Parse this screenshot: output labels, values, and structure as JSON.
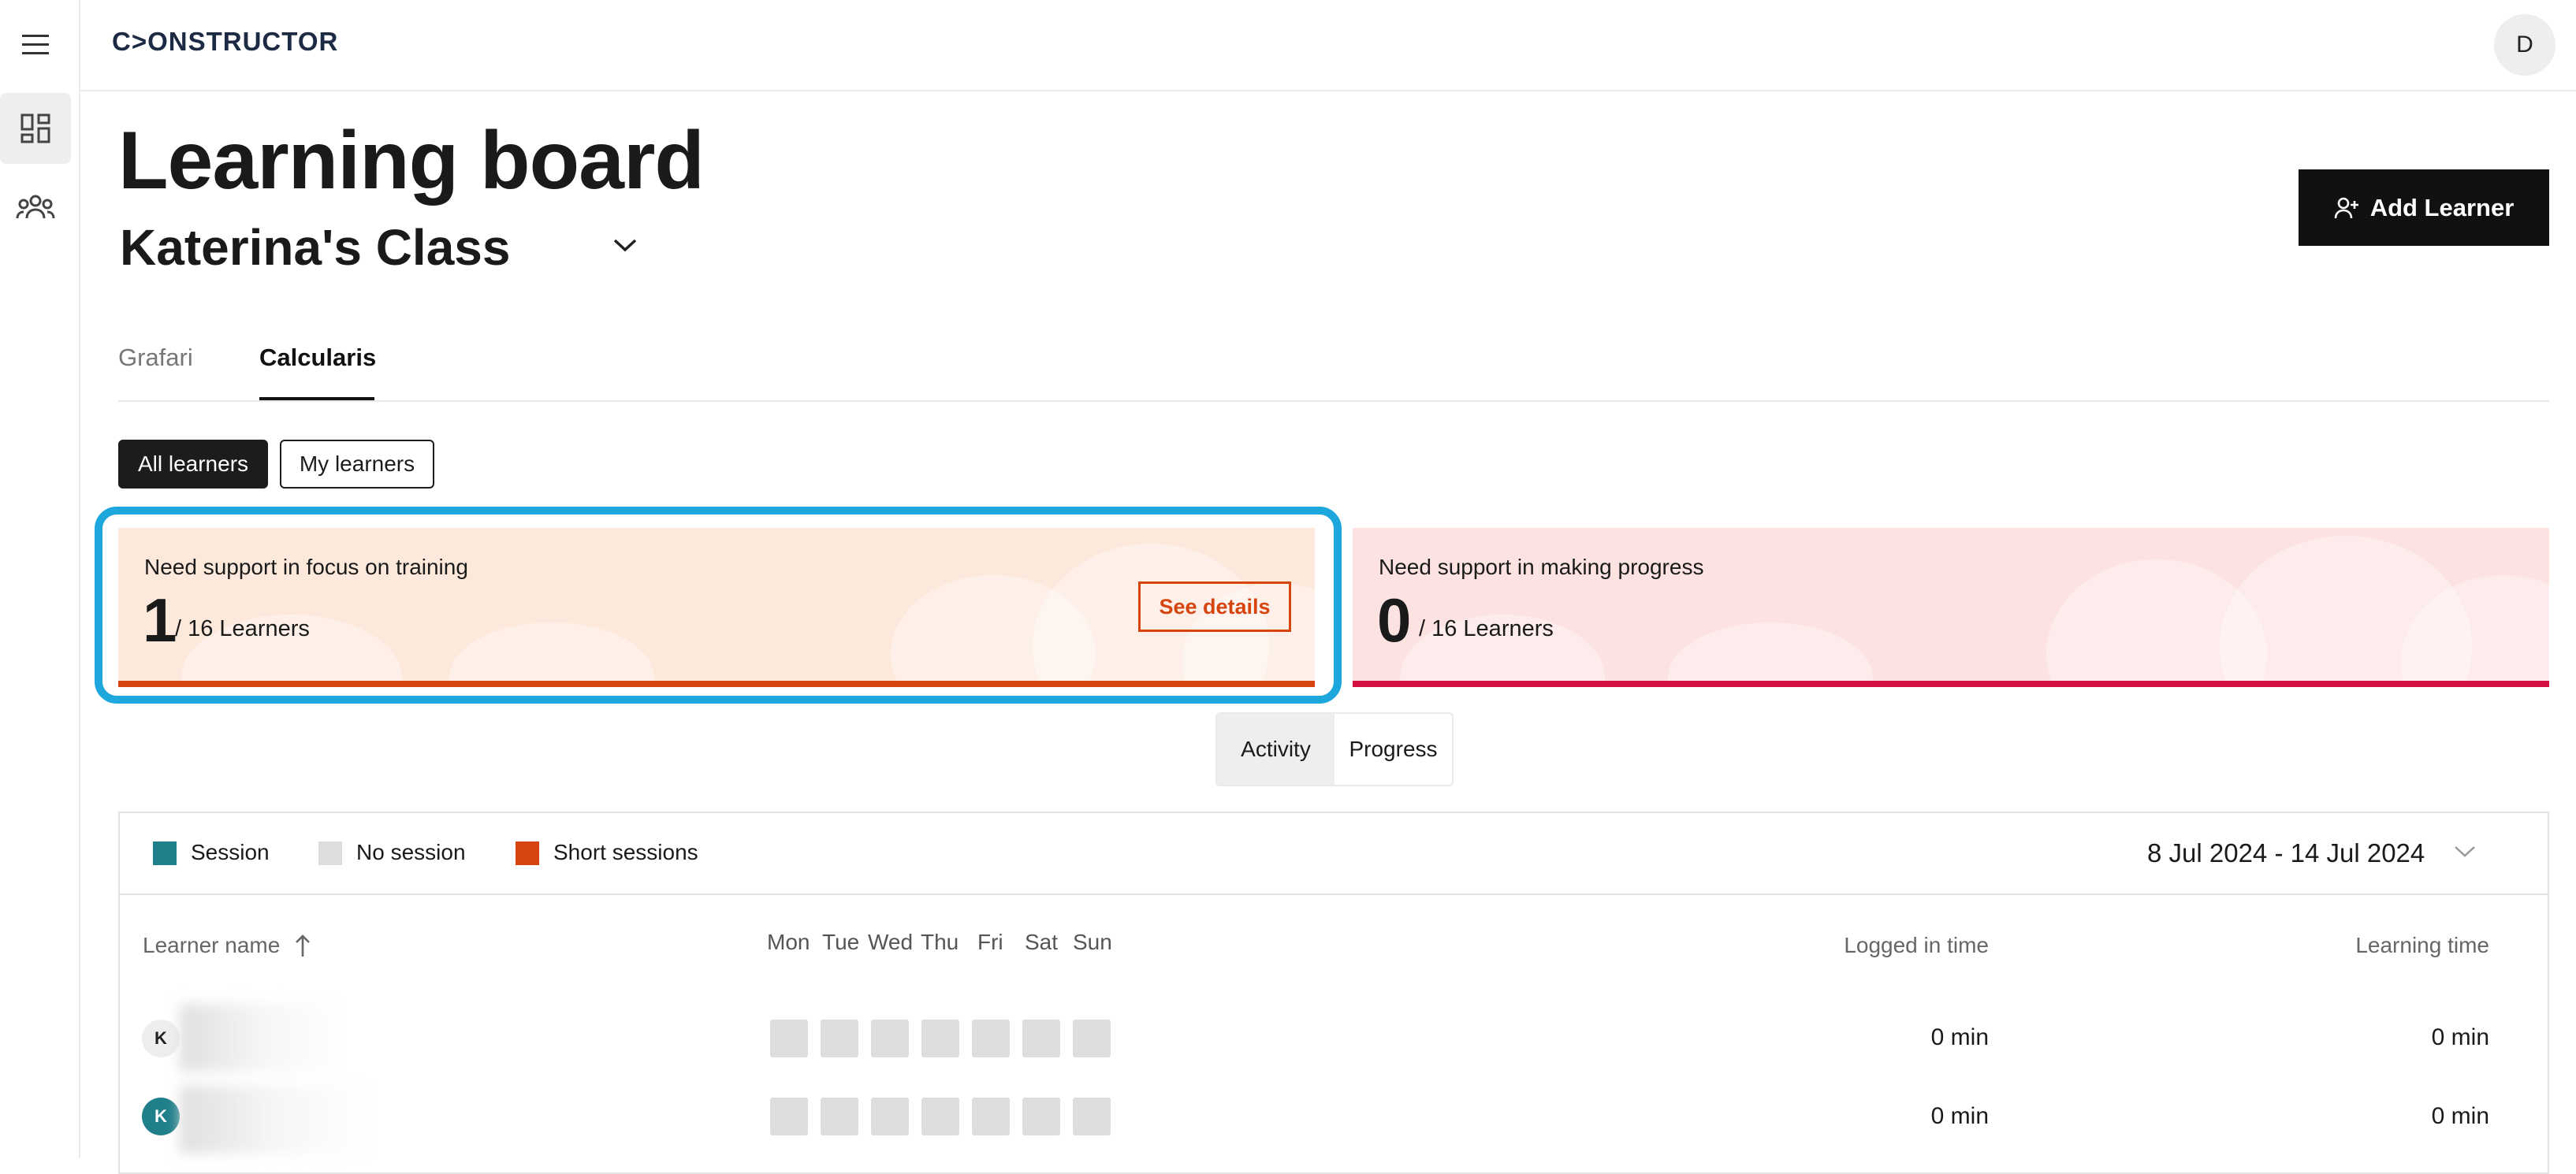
{
  "brand": {
    "logo": "C>ONSTRUCTOR"
  },
  "user": {
    "initial": "D"
  },
  "page": {
    "title": "Learning board",
    "class_name": "Katerina's Class"
  },
  "actions": {
    "add_learner": "Add Learner"
  },
  "tabs": [
    {
      "label": "Grafari",
      "active": false
    },
    {
      "label": "Calcularis",
      "active": true
    }
  ],
  "filters": {
    "all": "All learners",
    "mine": "My learners"
  },
  "cards": {
    "focus": {
      "label": "Need support in focus on training",
      "count": "1",
      "of": "/ 16 Learners",
      "cta": "See details",
      "accent": "#d7450f"
    },
    "progress": {
      "label": "Need support in making progress",
      "count": "0",
      "of": "/ 16 Learners",
      "accent": "#d31040"
    }
  },
  "view_toggle": {
    "activity": "Activity",
    "progress": "Progress",
    "selected": "Activity"
  },
  "legend": [
    {
      "label": "Session",
      "color": "#1f7f8a"
    },
    {
      "label": "No session",
      "color": "#dddddd"
    },
    {
      "label": "Short sessions",
      "color": "#d7450f"
    }
  ],
  "date_range": "8 Jul 2024 - 14 Jul 2024",
  "table": {
    "col_name": "Learner name",
    "days": [
      "Mon",
      "Tue",
      "Wed",
      "Thu",
      "Fri",
      "Sat",
      "Sun"
    ],
    "col_logged": "Logged in time",
    "col_learning": "Learning time",
    "rows": [
      {
        "initial": "K",
        "logged": "0 min",
        "learning": "0 min",
        "avatar_color": "#eeeeee"
      },
      {
        "initial": "K",
        "logged": "0 min",
        "learning": "0 min",
        "avatar_color": "#1f7f8a"
      }
    ]
  }
}
